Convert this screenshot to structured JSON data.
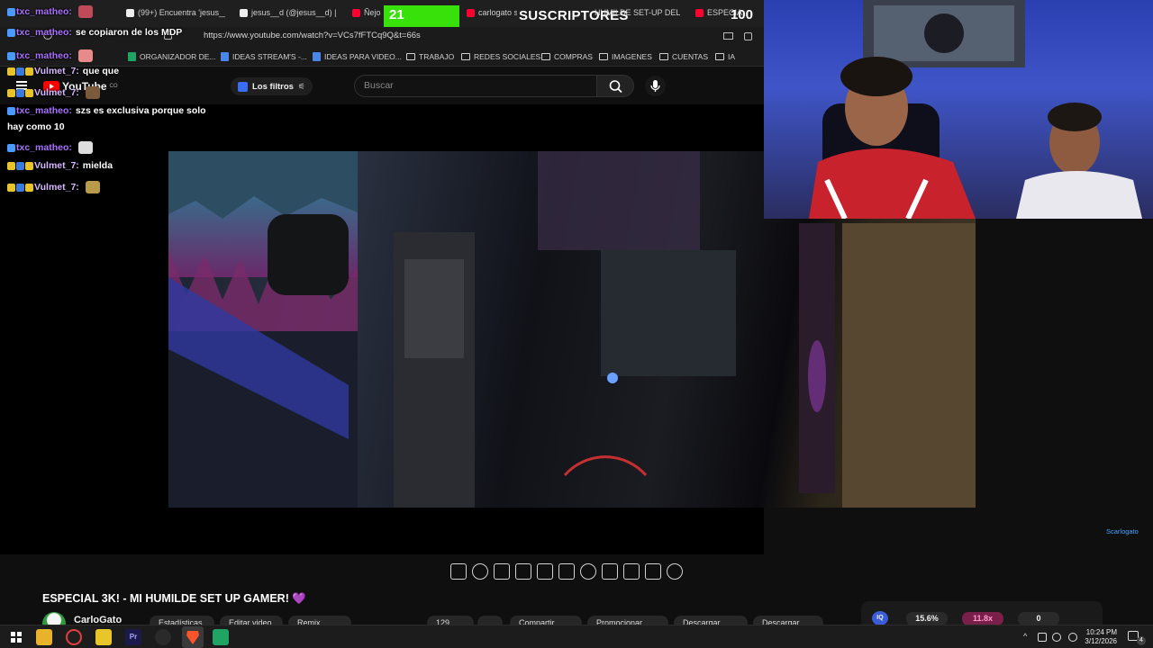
{
  "browser": {
    "tabs": [
      {
        "label": "(99+) Encuentra 'jesus__d'",
        "color": "#ffffff"
      },
      {
        "label": "jesus__d (@jesus__d) | Tik",
        "color": "#ffffff"
      },
      {
        "label": "Ñejo",
        "color": "#ff0033"
      },
      {
        "label": "carlogato se",
        "color": "#ff0033"
      },
      {
        "label": "HUMILDE SET-UP DEL",
        "color": "#ff0033"
      },
      {
        "label": "ESPECIA",
        "color": "#ff0033"
      }
    ],
    "url": "https://www.youtube.com/watch?v=VCs7fFTCq9Q&t=66s",
    "bookmarks": [
      {
        "label": "ORGANIZADOR DE...",
        "icon": "sheet-icon"
      },
      {
        "label": "IDEAS STREAM'S -...",
        "icon": "doc-icon"
      },
      {
        "label": "IDEAS PARA VIDEO...",
        "icon": "doc-icon"
      },
      {
        "label": "TRABAJO",
        "icon": "folder-icon"
      },
      {
        "label": "REDES SOCIALES",
        "icon": "folder-icon"
      },
      {
        "label": "COMPRAS",
        "icon": "folder-icon"
      },
      {
        "label": "IMAGENES",
        "icon": "folder-icon"
      },
      {
        "label": "CUENTAS",
        "icon": "folder-icon"
      },
      {
        "label": "IA",
        "icon": "folder-icon"
      }
    ]
  },
  "subscriber_goal": {
    "current": "21",
    "label": "SUSCRIPTORES",
    "goal": "100",
    "progress": 0.21,
    "fill_color": "#39e10a"
  },
  "youtube": {
    "logo": "YouTube",
    "country": "CO",
    "filters_label": "Los filtros",
    "search_placeholder": "Buscar"
  },
  "chat": [
    {
      "user": "txc_matheo:",
      "text": "",
      "style": "txc"
    },
    {
      "user": "txc_matheo:",
      "text": "se copiaron de los MDP",
      "style": "txc"
    },
    {
      "user": "txc_matheo:",
      "text": "",
      "style": "txc"
    },
    {
      "user": "Vulmet_7:",
      "text": "que que",
      "style": "vul"
    },
    {
      "user": "Vulmet_7:",
      "text": "",
      "style": "vul"
    },
    {
      "user": "txc_matheo:",
      "text": "szs es exclusiva porque solo",
      "style": "txc"
    },
    {
      "user": "",
      "text": "hay como 10",
      "style": "cont"
    },
    {
      "user": "txc_matheo:",
      "text": "",
      "style": "txc"
    },
    {
      "user": "Vulmet_7:",
      "text": "mielda",
      "style": "vul"
    },
    {
      "user": "Vulmet_7:",
      "text": "",
      "style": "vul"
    }
  ],
  "video": {
    "title": "ESPECIAL 3K! - MI HUMILDE SET UP GAMER!",
    "title_emoji": "💜",
    "channel": "CarloGato",
    "watermark": "Scarlogato",
    "actions": [
      "Estadísticas",
      "Editar video",
      "Remix",
      "129",
      "Compartir",
      "Promocionar",
      "Descargar",
      "Descargar"
    ]
  },
  "performance": {
    "cpu": "15.6%",
    "gpu": "11.8x",
    "count": "0",
    "gpu_color": "#7a1f4a"
  },
  "taskbar": {
    "time": "10:24 PM",
    "date": "3/12/2026",
    "notifications": "4"
  }
}
